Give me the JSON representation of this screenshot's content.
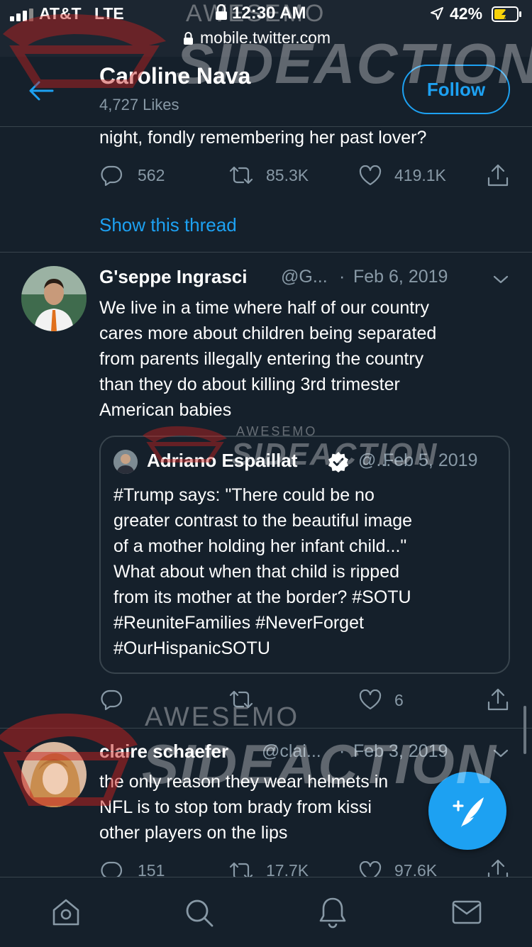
{
  "status_bar": {
    "carrier": "AT&T",
    "network": "LTE",
    "time": "12:30 AM",
    "url": "mobile.twitter.com",
    "battery": "42%"
  },
  "header": {
    "name": "Caroline Nava",
    "likes": "4,727 Likes",
    "follow_label": "Follow"
  },
  "tweet1": {
    "text_tail": "night, fondly remembering her past lover?",
    "replies": "562",
    "retweets": "85.3K",
    "likes": "419.1K",
    "show_thread": "Show this thread"
  },
  "tweet2": {
    "name": "G'seppe Ingrasci",
    "handle": "@G...",
    "separator": "·",
    "date": "Feb 6, 2019",
    "lines": [
      "We live in a time where half of our country",
      "cares more about children being separated",
      "from parents illegally entering the country",
      "than they do about killing 3rd trimester",
      "American babies"
    ],
    "quote": {
      "name": "Adriano Espaillat",
      "handle": "@...",
      "date": "Feb 5, 2019",
      "lines": [
        "#Trump says: \"There could be no",
        "greater contrast to the beautiful image",
        "of a mother holding her infant child...\"",
        "What about when that child is ripped",
        "from its mother at the border? #SOTU",
        "#ReuniteFamilies #NeverForget",
        "#OurHispanicSOTU"
      ]
    },
    "likes": "6"
  },
  "tweet3": {
    "name": "claire schaefer",
    "handle": "@clai...",
    "separator": "·",
    "date": "Feb 3, 2019",
    "lines": [
      "the only reason they wear helmets in",
      "NFL is to stop tom brady from kissi",
      "other players on the lips"
    ],
    "replies": "151",
    "retweets": "17.7K",
    "likes": "97.6K"
  },
  "watermarks": {
    "brand_top": "AWESEMO",
    "brand_main": "SIDEACTION"
  },
  "colors": {
    "background": "#15202b",
    "accent": "#1da1f2",
    "muted": "#8899a6",
    "divider": "#38444d"
  },
  "icons": {
    "back": "arrow-left-icon",
    "reply": "speech-bubble-icon",
    "retweet": "retweet-icon",
    "like": "heart-icon",
    "share": "share-icon",
    "caret": "chevron-down-icon",
    "verified": "verified-badge-icon",
    "compose": "compose-feather-icon",
    "home": "home-icon",
    "search": "search-icon",
    "notifications": "bell-icon",
    "messages": "mail-icon"
  }
}
